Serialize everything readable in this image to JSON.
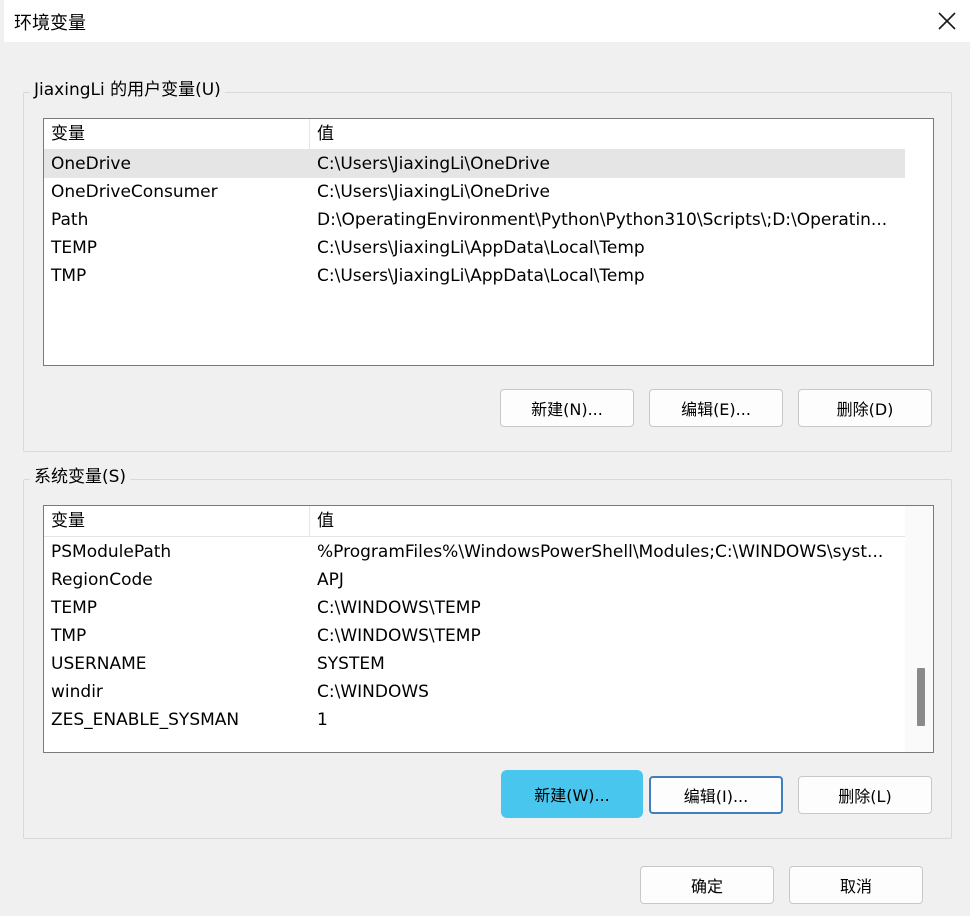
{
  "window": {
    "title": "环境变量",
    "close_icon": "close-icon"
  },
  "user_vars": {
    "group_label": "JiaxingLi 的用户变量(U)",
    "columns": [
      "变量",
      "值"
    ],
    "rows": [
      {
        "name": "OneDrive",
        "value": "C:\\Users\\JiaxingLi\\OneDrive",
        "selected": true
      },
      {
        "name": "OneDriveConsumer",
        "value": "C:\\Users\\JiaxingLi\\OneDrive"
      },
      {
        "name": "Path",
        "value": "D:\\OperatingEnvironment\\Python\\Python310\\Scripts\\;D:\\Operatin..."
      },
      {
        "name": "TEMP",
        "value": "C:\\Users\\JiaxingLi\\AppData\\Local\\Temp"
      },
      {
        "name": "TMP",
        "value": "C:\\Users\\JiaxingLi\\AppData\\Local\\Temp"
      }
    ],
    "buttons": {
      "new": "新建(N)...",
      "edit": "编辑(E)...",
      "delete": "删除(D)"
    }
  },
  "system_vars": {
    "group_label": "系统变量(S)",
    "columns": [
      "变量",
      "值"
    ],
    "rows": [
      {
        "name": "PSModulePath",
        "value": "%ProgramFiles%\\WindowsPowerShell\\Modules;C:\\WINDOWS\\syst..."
      },
      {
        "name": "RegionCode",
        "value": "APJ"
      },
      {
        "name": "TEMP",
        "value": "C:\\WINDOWS\\TEMP"
      },
      {
        "name": "TMP",
        "value": "C:\\WINDOWS\\TEMP"
      },
      {
        "name": "USERNAME",
        "value": "SYSTEM"
      },
      {
        "name": "windir",
        "value": "C:\\WINDOWS"
      },
      {
        "name": "ZES_ENABLE_SYSMAN",
        "value": "1"
      }
    ],
    "buttons": {
      "new": "新建(W)...",
      "edit": "编辑(I)...",
      "delete": "删除(L)"
    },
    "highlight_color": "#49c6ee"
  },
  "footer": {
    "ok": "确定",
    "cancel": "取消"
  }
}
